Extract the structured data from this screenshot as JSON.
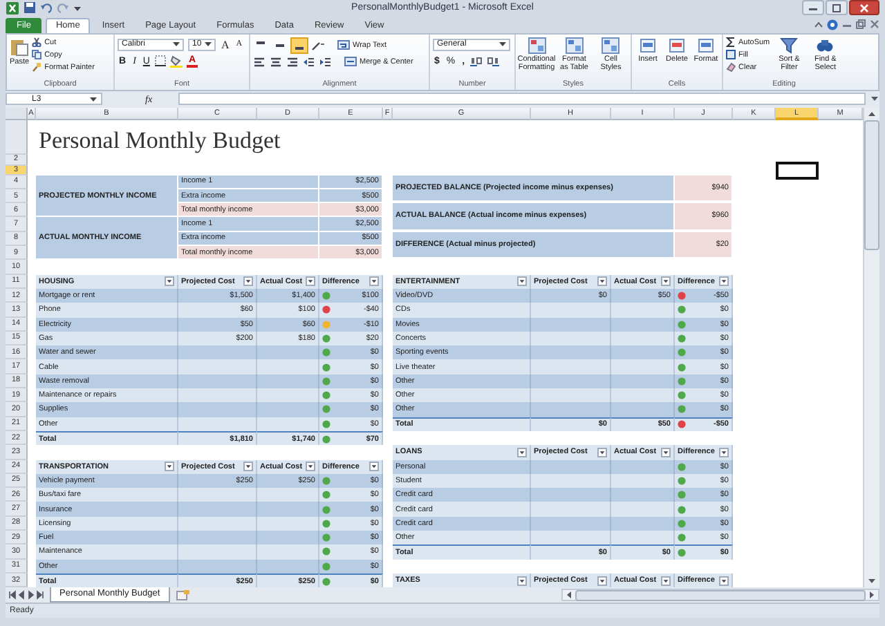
{
  "window": {
    "title": "PersonalMonthlyBudget1 - Microsoft Excel"
  },
  "ribbon_tabs": [
    {
      "label": "File",
      "kind": "file",
      "selected": false
    },
    {
      "label": "Home",
      "kind": "tab",
      "selected": true
    },
    {
      "label": "Insert",
      "kind": "tab",
      "selected": false
    },
    {
      "label": "Page Layout",
      "kind": "tab",
      "selected": false
    },
    {
      "label": "Formulas",
      "kind": "tab",
      "selected": false
    },
    {
      "label": "Data",
      "kind": "tab",
      "selected": false
    },
    {
      "label": "Review",
      "kind": "tab",
      "selected": false
    },
    {
      "label": "View",
      "kind": "tab",
      "selected": false
    }
  ],
  "clipboard": {
    "group": "Clipboard",
    "paste": "Paste",
    "cut": "Cut",
    "copy": "Copy",
    "format_painter": "Format Painter"
  },
  "font": {
    "group": "Font",
    "family": "Calibri",
    "size": "10",
    "grow": "A",
    "shrink": "A",
    "bold": "B",
    "italic": "I",
    "underline": "U",
    "font_color_button": "A"
  },
  "alignment": {
    "group": "Alignment",
    "wrap": "Wrap Text",
    "merge": "Merge & Center",
    "vertical": [
      {
        "selected": false
      },
      {
        "selected": false
      },
      {
        "selected": true
      }
    ]
  },
  "number": {
    "group": "Number",
    "format": "General",
    "currency": "$",
    "percent": "%",
    "comma": ","
  },
  "styles": {
    "group": "Styles",
    "buttons": [
      "Conditional Formatting",
      "Format as Table",
      "Cell Styles"
    ]
  },
  "cells": {
    "group": "Cells",
    "buttons": [
      "Insert",
      "Delete",
      "Format"
    ]
  },
  "editing": {
    "group": "Editing",
    "small": [
      "AutoSum",
      "Fill",
      "Clear"
    ],
    "large": [
      "Sort & Filter",
      "Find & Select"
    ]
  },
  "formula_bar": {
    "name_box": "L3",
    "fx": "fx"
  },
  "columns": [
    {
      "label": "A",
      "selected": false
    },
    {
      "label": "B",
      "selected": false
    },
    {
      "label": "C",
      "selected": false
    },
    {
      "label": "D",
      "selected": false
    },
    {
      "label": "E",
      "selected": false
    },
    {
      "label": "F",
      "selected": false
    },
    {
      "label": "G",
      "selected": false
    },
    {
      "label": "H",
      "selected": false
    },
    {
      "label": "I",
      "selected": false
    },
    {
      "label": "J",
      "selected": false
    },
    {
      "label": "K",
      "selected": false
    },
    {
      "label": "L",
      "selected": true
    },
    {
      "label": "M",
      "selected": false
    }
  ],
  "rows": [
    {
      "label": "2",
      "selected": false
    },
    {
      "label": "3",
      "selected": true
    },
    {
      "label": "4",
      "selected": false
    },
    {
      "label": "5",
      "selected": false
    },
    {
      "label": "6",
      "selected": false
    },
    {
      "label": "7",
      "selected": false
    },
    {
      "label": "8",
      "selected": false
    },
    {
      "label": "9",
      "selected": false
    },
    {
      "label": "10",
      "selected": false
    },
    {
      "label": "11",
      "selected": false
    },
    {
      "label": "12",
      "selected": false
    },
    {
      "label": "13",
      "selected": false
    },
    {
      "label": "14",
      "selected": false
    },
    {
      "label": "15",
      "selected": false
    },
    {
      "label": "16",
      "selected": false
    },
    {
      "label": "17",
      "selected": false
    },
    {
      "label": "18",
      "selected": false
    },
    {
      "label": "19",
      "selected": false
    },
    {
      "label": "20",
      "selected": false
    },
    {
      "label": "21",
      "selected": false
    },
    {
      "label": "22",
      "selected": false
    },
    {
      "label": "23",
      "selected": false
    },
    {
      "label": "24",
      "selected": false
    },
    {
      "label": "25",
      "selected": false
    },
    {
      "label": "26",
      "selected": false
    },
    {
      "label": "27",
      "selected": false
    },
    {
      "label": "28",
      "selected": false
    },
    {
      "label": "29",
      "selected": false
    },
    {
      "label": "30",
      "selected": false
    },
    {
      "label": "31",
      "selected": false
    },
    {
      "label": "32",
      "selected": false
    }
  ],
  "sheet": {
    "title": "Personal Monthly Budget",
    "income": [
      {
        "label": "PROJECTED MONTHLY INCOME",
        "items": [
          {
            "label": "Income 1",
            "value": "$2,500",
            "kind": "item"
          },
          {
            "label": "Extra income",
            "value": "$500",
            "kind": "item"
          },
          {
            "label": "Total monthly income",
            "value": "$3,000",
            "kind": "total"
          }
        ]
      },
      {
        "label": "ACTUAL MONTHLY INCOME",
        "items": [
          {
            "label": "Income 1",
            "value": "$2,500",
            "kind": "item"
          },
          {
            "label": "Extra income",
            "value": "$500",
            "kind": "item"
          },
          {
            "label": "Total monthly income",
            "value": "$3,000",
            "kind": "total"
          }
        ]
      }
    ],
    "balances": [
      {
        "label": "PROJECTED BALANCE (Projected income minus expenses)",
        "value": "$940"
      },
      {
        "label": "ACTUAL BALANCE (Actual income minus expenses)",
        "value": "$960"
      },
      {
        "label": "DIFFERENCE (Actual minus projected)",
        "value": "$20"
      }
    ],
    "left_tables": [
      {
        "title": "HOUSING",
        "columns": [
          "Projected Cost",
          "Actual Cost",
          "Difference"
        ],
        "rows": [
          {
            "name": "Mortgage or rent",
            "projected": "$1,500",
            "actual": "$1,400",
            "color": "#4fa84a",
            "difference": "$100"
          },
          {
            "name": "Phone",
            "projected": "$60",
            "actual": "$100",
            "color": "#e0424a",
            "difference": "-$40"
          },
          {
            "name": "Electricity",
            "projected": "$50",
            "actual": "$60",
            "color": "#f0b430",
            "difference": "-$10"
          },
          {
            "name": "Gas",
            "projected": "$200",
            "actual": "$180",
            "color": "#4fa84a",
            "difference": "$20"
          },
          {
            "name": "Water and sewer",
            "color": "#4fa84a",
            "difference": "$0"
          },
          {
            "name": "Cable",
            "color": "#4fa84a",
            "difference": "$0"
          },
          {
            "name": "Waste removal",
            "color": "#4fa84a",
            "difference": "$0"
          },
          {
            "name": "Maintenance or repairs",
            "color": "#4fa84a",
            "difference": "$0"
          },
          {
            "name": "Supplies",
            "color": "#4fa84a",
            "difference": "$0"
          },
          {
            "name": "Other",
            "color": "#4fa84a",
            "difference": "$0"
          }
        ],
        "total": {
          "name": "Total",
          "projected": "$1,810",
          "actual": "$1,740",
          "color": "#4fa84a",
          "difference": "$70"
        }
      },
      {
        "title": "TRANSPORTATION",
        "columns": [
          "Projected Cost",
          "Actual Cost",
          "Difference"
        ],
        "rows": [
          {
            "name": "Vehicle payment",
            "projected": "$250",
            "actual": "$250",
            "color": "#4fa84a",
            "difference": "$0"
          },
          {
            "name": "Bus/taxi fare",
            "color": "#4fa84a",
            "difference": "$0"
          },
          {
            "name": "Insurance",
            "color": "#4fa84a",
            "difference": "$0"
          },
          {
            "name": "Licensing",
            "color": "#4fa84a",
            "difference": "$0"
          },
          {
            "name": "Fuel",
            "color": "#4fa84a",
            "difference": "$0"
          },
          {
            "name": "Maintenance",
            "color": "#4fa84a",
            "difference": "$0"
          },
          {
            "name": "Other",
            "color": "#4fa84a",
            "difference": "$0"
          }
        ],
        "total": {
          "name": "Total",
          "projected": "$250",
          "actual": "$250",
          "color": "#4fa84a",
          "difference": "$0"
        }
      }
    ],
    "right_tables": [
      {
        "title": "ENTERTAINMENT",
        "columns": [
          "Projected Cost",
          "Actual Cost",
          "Difference"
        ],
        "rows": [
          {
            "name": "Video/DVD",
            "projected": "$0",
            "actual": "$50",
            "color": "#e0424a",
            "difference": "-$50"
          },
          {
            "name": "CDs",
            "color": "#4fa84a",
            "difference": "$0"
          },
          {
            "name": "Movies",
            "color": "#4fa84a",
            "difference": "$0"
          },
          {
            "name": "Concerts",
            "color": "#4fa84a",
            "difference": "$0"
          },
          {
            "name": "Sporting events",
            "color": "#4fa84a",
            "difference": "$0"
          },
          {
            "name": "Live theater",
            "color": "#4fa84a",
            "difference": "$0"
          },
          {
            "name": "Other",
            "color": "#4fa84a",
            "difference": "$0"
          },
          {
            "name": "Other",
            "color": "#4fa84a",
            "difference": "$0"
          },
          {
            "name": "Other",
            "color": "#4fa84a",
            "difference": "$0"
          }
        ],
        "total": {
          "name": "Total",
          "projected": "$0",
          "actual": "$50",
          "color": "#e0424a",
          "difference": "-$50"
        }
      },
      {
        "title": "LOANS",
        "columns": [
          "Projected Cost",
          "Actual Cost",
          "Difference"
        ],
        "rows": [
          {
            "name": "Personal",
            "color": "#4fa84a",
            "difference": "$0"
          },
          {
            "name": "Student",
            "color": "#4fa84a",
            "difference": "$0"
          },
          {
            "name": "Credit card",
            "color": "#4fa84a",
            "difference": "$0"
          },
          {
            "name": "Credit card",
            "color": "#4fa84a",
            "difference": "$0"
          },
          {
            "name": "Credit card",
            "color": "#4fa84a",
            "difference": "$0"
          },
          {
            "name": "Other",
            "color": "#4fa84a",
            "difference": "$0"
          }
        ],
        "total": {
          "name": "Total",
          "projected": "$0",
          "actual": "$0",
          "color": "#4fa84a",
          "difference": "$0"
        }
      },
      {
        "title": "TAXES",
        "columns": [
          "Projected Cost",
          "Actual Cost",
          "Difference"
        ]
      }
    ]
  },
  "sheet_tabs": [
    {
      "label": "Personal Monthly Budget",
      "selected": true
    }
  ],
  "status_bar": {
    "text": "Ready"
  }
}
